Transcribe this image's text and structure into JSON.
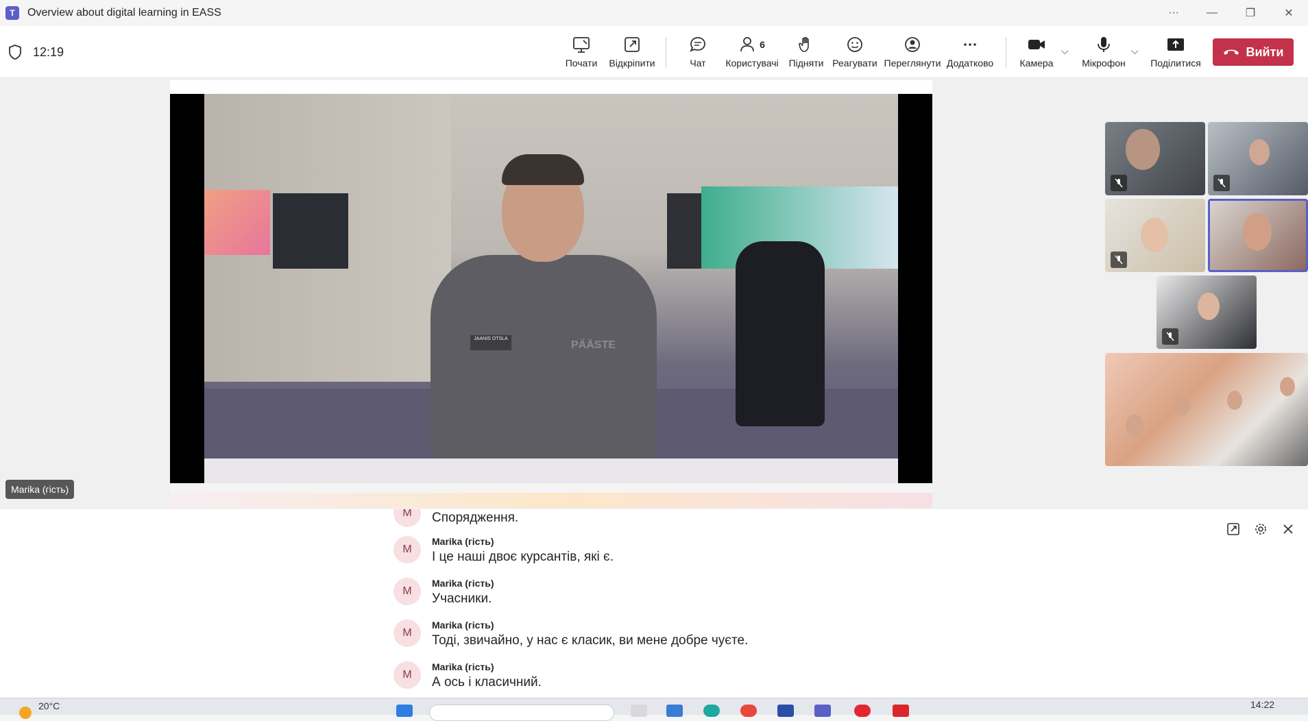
{
  "window": {
    "title": "Overview about digital learning in EASS",
    "app_badge": "T"
  },
  "meeting": {
    "time": "12:19",
    "toolbar": [
      {
        "label": "Почати",
        "icon": "whiteboard-icon"
      },
      {
        "label": "Відкріпити",
        "icon": "popout-icon"
      },
      {
        "label": "Чат",
        "icon": "chat-icon"
      },
      {
        "label": "Користувачі",
        "icon": "people-icon",
        "count": "6"
      },
      {
        "label": "Підняти",
        "icon": "raise-hand-icon"
      },
      {
        "label": "Реагувати",
        "icon": "react-icon"
      },
      {
        "label": "Переглянути",
        "icon": "view-icon"
      },
      {
        "label": "Додатково",
        "icon": "more-icon"
      },
      {
        "label": "Камера",
        "icon": "camera-icon"
      },
      {
        "label": "Мікрофон",
        "icon": "mic-icon"
      },
      {
        "label": "Поділитися",
        "icon": "share-icon"
      }
    ],
    "leave_label": "Вийти",
    "leave_color": "#c4314b",
    "accent": "#5b5fc7"
  },
  "shared_video": {
    "name_tag": "JAANIS OTSLA",
    "badge_text": "PÄÄSTE"
  },
  "presenter_label": "Marika (гість)",
  "captions": [
    {
      "speaker": "",
      "initial": "M",
      "text": "Спорядження."
    },
    {
      "speaker": "Marika (гість)",
      "initial": "M",
      "text": "І це наші двоє курсантів, які є."
    },
    {
      "speaker": "Marika (гість)",
      "initial": "M",
      "text": "Учасники."
    },
    {
      "speaker": "Marika (гість)",
      "initial": "M",
      "text": "Тоді, звичайно, у нас є класик, ви мене добре чуєте."
    },
    {
      "speaker": "Marika (гість)",
      "initial": "M",
      "text": "А ось і класичний."
    }
  ],
  "taskbar": {
    "weather": "20°C",
    "clock": "14:22"
  }
}
